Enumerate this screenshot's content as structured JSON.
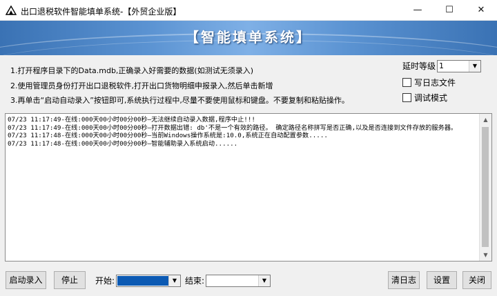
{
  "window": {
    "title": "出口退税软件智能填单系统-【外贸企业版】",
    "icon": "app-arrow-icon",
    "controls": {
      "minimize": "—",
      "maximize": "☐",
      "close": "✕"
    }
  },
  "banner": {
    "title": "【智能填单系统】"
  },
  "instructions": [
    "1.打开程序目录下的Data.mdb,正确录入好需要的数据(如测试无须录入)",
    "2.使用管理员身份打开出口退税软件,打开出口货物明细申报录入,然后单击新增",
    "3.再单击“启动自动录入”按钮即可,系统执行过程中,尽量不要使用鼠标和键盘。不要复制和粘贴操作。"
  ],
  "settings": {
    "delay_label": "延时等级",
    "delay_value": "1",
    "write_log_label": "写日志文件",
    "debug_mode_label": "调试模式"
  },
  "log": {
    "lines": [
      "07/23 11:17:49-在线:000天00小时00分00秒—无法继续自动录入数据,程序中止!!!",
      "07/23 11:17:49-在线:000天00小时00分00秒—打开数据出错:                          db'不是一个有效的路径。 确定路径名称拼写是否正确,以及是否连接到文件存放的服务器。",
      "07/23 11:17:48-在线:000天00小时00分00秒—当前Windows操作系统是:10.0,系统正在自动配置参数.....",
      "07/23 11:17:48-在线:000天00小时00分00秒—智能辅助录入系统启动......"
    ]
  },
  "toolbar": {
    "start_button": "启动录入",
    "stop_button": "停止",
    "start_label": "开始:",
    "end_label": "结束:",
    "clear_log_button": "清日志",
    "settings_button": "设置",
    "close_button": "关闭"
  },
  "colors": {
    "banner_accent": "#5b93d2",
    "selection": "#0c5ab3",
    "window_bg": "#f0f0f0"
  }
}
